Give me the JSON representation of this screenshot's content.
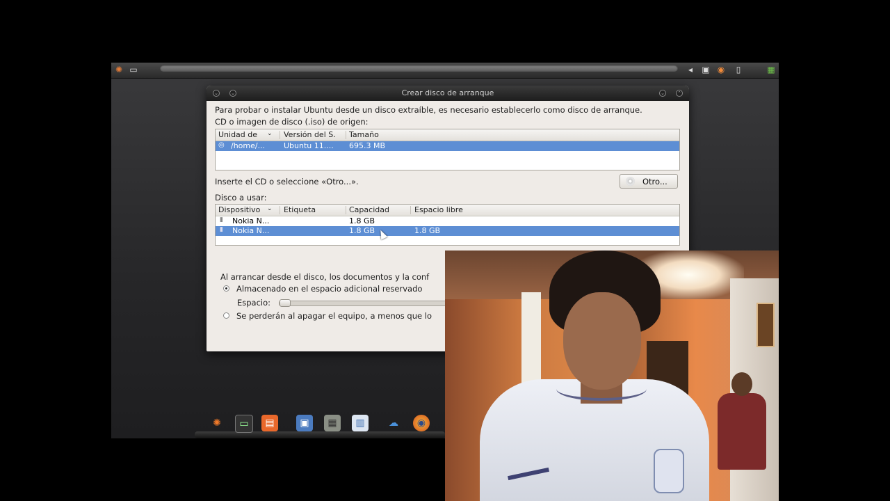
{
  "window": {
    "title": "Crear disco de arranque",
    "intro": "Para probar o instalar Ubuntu desde un disco extraíble, es necesario establecerlo como disco de arranque.",
    "source_label": "CD o imagen de disco (.iso) de origen:",
    "source_table": {
      "headers": [
        "Unidad de",
        "Versión del S.",
        "Tamaño"
      ],
      "rows": [
        {
          "unit": "/home/...",
          "version": "Ubuntu 11....",
          "size": "695.3 MB"
        }
      ]
    },
    "insert_label": "Inserte el CD o seleccione «Otro...».",
    "otro_button": "Otro...",
    "disk_label": "Disco a usar:",
    "disk_table": {
      "headers": [
        "Dispositivo",
        "Etiqueta",
        "Capacidad",
        "Espacio libre"
      ],
      "rows": [
        {
          "device": "Nokia N...",
          "label": "",
          "capacity": "1.8 GB",
          "free": ""
        },
        {
          "device": "Nokia N...",
          "label": "",
          "capacity": "1.8 GB",
          "free": "1.8 GB"
        }
      ]
    },
    "boot_note": "Al arrancar desde el disco, los documentos y la conf",
    "option_stored": "Almacenado en el espacio adicional reservado",
    "space_label": "Espacio:",
    "option_lost": "Se perderán al apagar el equipo, a menos que lo"
  },
  "colors": {
    "selection": "#5d8ed4",
    "window_bg": "#efebe7",
    "titlebar": "#2a2a2a"
  },
  "dock": {
    "icons": [
      "ubuntu-icon",
      "terminal-icon",
      "clapper-icon",
      "display-icon",
      "calculator-icon",
      "document-icon",
      "weather-icon",
      "firefox-icon"
    ]
  }
}
